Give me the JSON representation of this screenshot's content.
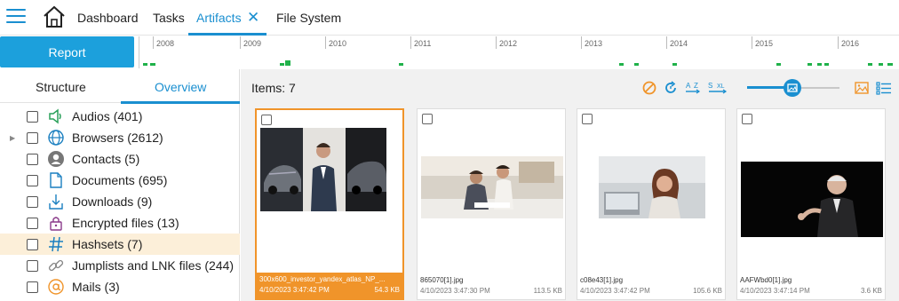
{
  "nav": {
    "tabs": [
      {
        "label": "Dashboard"
      },
      {
        "label": "Tasks"
      },
      {
        "label": "Artifacts",
        "active": true
      },
      {
        "label": "File System"
      }
    ]
  },
  "report": {
    "label": "Report"
  },
  "timeline": {
    "years": [
      "2008",
      "2009",
      "2010",
      "2011",
      "2012",
      "2013",
      "2014",
      "2015",
      "2016"
    ]
  },
  "left_panel": {
    "tabs": [
      {
        "label": "Structure"
      },
      {
        "label": "Overview",
        "active": true
      }
    ],
    "items": [
      {
        "label": "Audios (401)",
        "icon": "speaker-icon",
        "expandable": false,
        "selected": false
      },
      {
        "label": "Browsers (2612)",
        "icon": "globe-icon",
        "expandable": true,
        "selected": false
      },
      {
        "label": "Contacts (5)",
        "icon": "person-icon",
        "expandable": false,
        "selected": false
      },
      {
        "label": "Documents (695)",
        "icon": "document-icon",
        "expandable": false,
        "selected": false
      },
      {
        "label": "Downloads (9)",
        "icon": "download-icon",
        "expandable": false,
        "selected": false
      },
      {
        "label": "Encrypted files (13)",
        "icon": "lock-icon",
        "expandable": false,
        "selected": false
      },
      {
        "label": "Hashsets (7)",
        "icon": "hash-icon",
        "expandable": false,
        "selected": true
      },
      {
        "label": "Jumplists and LNK files (244)",
        "icon": "link-icon",
        "expandable": false,
        "selected": false
      },
      {
        "label": "Mails (3)",
        "icon": "at-icon",
        "expandable": false,
        "selected": false
      }
    ]
  },
  "right_panel": {
    "items_label": "Items: 7",
    "toolbar_icons": [
      "block-icon",
      "refresh-icon",
      "sort-az-icon",
      "sort-size-icon",
      "image-view-icon",
      "list-view-icon"
    ],
    "zoom_level": 0.5,
    "cards": [
      {
        "filename": "300x600_investor_yandex_atlas_NP_...",
        "date": "4/10/2023 3:47:42 PM",
        "size": "54.3 KB",
        "selected": true
      },
      {
        "filename": "865070[1].jpg",
        "date": "4/10/2023 3:47:30 PM",
        "size": "113.5 KB",
        "selected": false
      },
      {
        "filename": "c08e43[1].jpg",
        "date": "4/10/2023 3:47:42 PM",
        "size": "105.6 KB",
        "selected": false
      },
      {
        "filename": "AAFWbd0[1].jpg",
        "date": "4/10/2023 3:47:14 PM",
        "size": "3.6 KB",
        "selected": false
      }
    ]
  },
  "colors": {
    "accent": "#1a8fd0",
    "report": "#1ca0dc",
    "selection": "#f0942a",
    "timeline_mark": "#20b24a"
  }
}
